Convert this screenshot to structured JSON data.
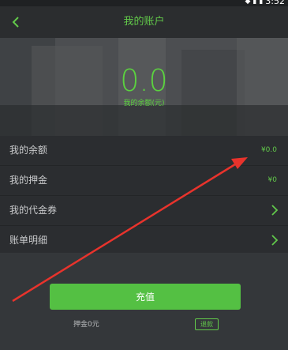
{
  "status_bar": {
    "time": "3:52"
  },
  "header": {
    "title": "我的账户"
  },
  "hero": {
    "amount": "0.0",
    "caption": "我的余额(元)"
  },
  "rows": [
    {
      "label": "我的余额",
      "value": "¥0.0"
    },
    {
      "label": "我的押金",
      "value": "¥0"
    },
    {
      "label": "我的代金券"
    },
    {
      "label": "账单明细"
    }
  ],
  "footer": {
    "recharge_label": "充值",
    "deposit_text": "押金0元",
    "refund_label": "退款"
  },
  "colors": {
    "accent": "#5bd23f",
    "button": "#54c043",
    "annotation_arrow": "#e8332c"
  }
}
